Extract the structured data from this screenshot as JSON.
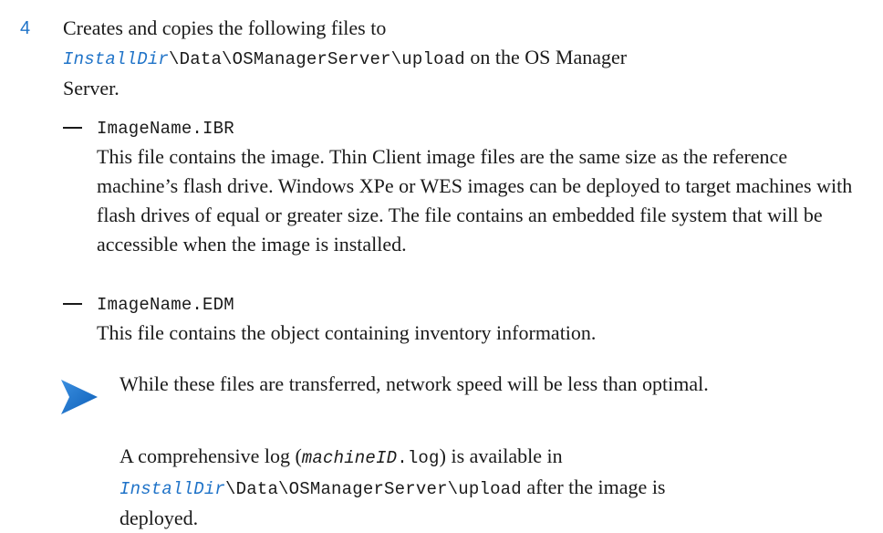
{
  "step": {
    "number": "4",
    "text_before": "Creates and copies the following files to",
    "install_dir": "InstallDir",
    "path": "\\Data\\OSManagerServer\\upload",
    "text_after": "on the OS Manager",
    "text_end": "Server."
  },
  "files": [
    {
      "dash": "—",
      "name": "ImageName.IBR",
      "description": "This file contains the image. Thin Client image files are the same size as the reference machine’s flash drive. Windows XPe or WES images can be deployed to target machines with flash drives of equal or greater size. The file contains an embedded file system that will be accessible when the image is installed."
    },
    {
      "dash": "—",
      "name": "ImageName.EDM",
      "description": "This file contains the object containing inventory information."
    }
  ],
  "note": {
    "icon": "note-arrow-icon",
    "text": "While these files are transferred, network speed will be less than optimal.",
    "log_before": "A comprehensive log (",
    "log_var": "machineID",
    "log_ext": ".log",
    "log_mid": ") is available in",
    "install_dir": "InstallDir",
    "path": "\\Data\\OSManagerServer\\upload",
    "log_after": "after the image is",
    "log_end": "deployed."
  },
  "colors": {
    "accent": "#1f73c8",
    "text": "#1a1a1a"
  }
}
